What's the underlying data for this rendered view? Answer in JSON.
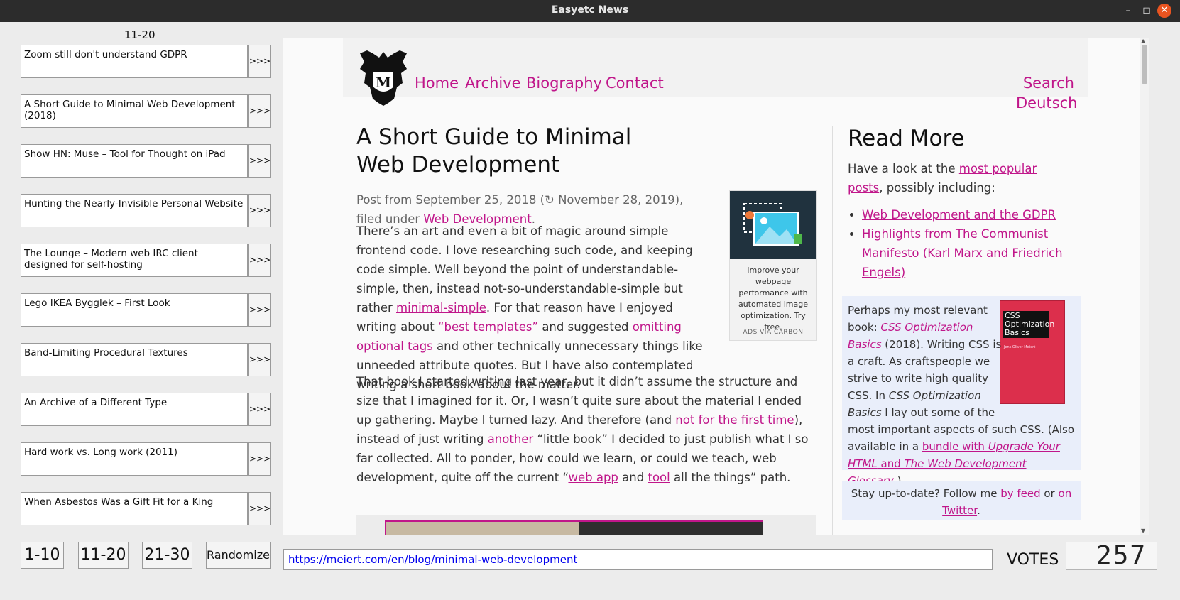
{
  "window": {
    "title": "Easyetc News",
    "minimize_glyph": "–",
    "maximize_glyph": "◻",
    "close_glyph": "✕"
  },
  "sidebar": {
    "page_label": "11-20",
    "open_label": ">>>",
    "stories": [
      {
        "title": "Zoom still don't understand GDPR"
      },
      {
        "title": "A Short Guide to Minimal Web Development (2018)"
      },
      {
        "title": "Show HN: Muse – Tool for Thought on iPad"
      },
      {
        "title": "Hunting the Nearly-Invisible Personal Website"
      },
      {
        "title": "The Lounge – Modern web IRC client designed for self-hosting"
      },
      {
        "title": "Lego IKEA Bygglek – First Look"
      },
      {
        "title": "Band-Limiting Procedural Textures"
      },
      {
        "title": "An Archive of a Different Type"
      },
      {
        "title": "Hard work vs. Long work (2011)"
      },
      {
        "title": "When Asbestos Was a Gift Fit for a King"
      }
    ],
    "page_buttons": [
      "1-10",
      "11-20",
      "21-30"
    ],
    "randomize_label": "Randomize"
  },
  "address": {
    "url": "https://meiert.com/en/blog/minimal-web-development"
  },
  "votes": {
    "label": "VOTES",
    "count": "257"
  },
  "site": {
    "nav": [
      "Home",
      "Archive",
      "Biography",
      "Contact"
    ],
    "search_label": "Search",
    "language_label": "Deutsch",
    "logo_letter": "M"
  },
  "article": {
    "title": "A Short Guide to Minimal Web Development",
    "meta_prefix": "Post from September 25, 2018 (↻ November 28, 2019), filed under ",
    "meta_category": "Web Development",
    "meta_suffix": ".",
    "p1": {
      "a": "There’s an art and even a bit of magic around simple frontend code. I love researching such code, and keeping code simple. Well beyond the point of understandable-simple, then, instead not-so-understandable-simple but rather ",
      "link1": "minimal-simple",
      "b": ". For that reason have I enjoyed writing about ",
      "link2": "“best templates”",
      "c": " and suggested ",
      "link3": "omitting optional tags",
      "d": " and other technically unnecessary things like unneeded attribute quotes. But I have also contemplated writing a short book about the matter."
    },
    "p2": {
      "a": "That book I started writing last year, but it didn’t assume the structure and size that I imagined for it. Or, I wasn’t quite sure about the material I ended up gathering. Maybe I turned lazy. And therefore (and ",
      "link1": "not for the first time",
      "b": "), instead of just writing ",
      "link2": "another",
      "c": " “little book” I decided to just publish what I so far collected. All to ponder, how could we learn, or could we teach, web development, quite off the current “",
      "link3": "web app",
      "d": " and ",
      "link4": "tool",
      "e": " all the things” path."
    }
  },
  "ad": {
    "text": "Improve your webpage performance with automated image optimization. Try free.",
    "via": "ADS VIA CARBON"
  },
  "read_more": {
    "title": "Read More",
    "intro_prefix": "Have a look at the ",
    "intro_link": "most popular posts",
    "intro_suffix": ", possibly including:",
    "items": [
      "Web Development and the GDPR",
      "Highlights from The Communist Manifesto (Karl Marx and Friedrich Engels)"
    ],
    "book": {
      "t1": "Perhaps my most relevant book: ",
      "link_title": "CSS Optimization Basics",
      "t2": " (2018). Writing CSS is a craft. As craftspeople we strive to write high quality CSS. In ",
      "em_title": "CSS Optimization Basics",
      "t3": " I lay out some of the most important aspects of such CSS. (Also available in a ",
      "link_bundle_a": "bundle with ",
      "link_bundle_em1": "Upgrade Your HTML",
      "link_bundle_b": " and ",
      "link_bundle_em2": "The Web Development Glossary",
      "t4": ".)",
      "cover_title": "CSS Optimization Basics",
      "cover_author": "Jens Oliver Meiert"
    },
    "stay": {
      "t1": "Stay up-to-date? Follow me ",
      "link1": "by feed",
      "t2": " or ",
      "link2": "on Twitter",
      "t3": "."
    }
  }
}
